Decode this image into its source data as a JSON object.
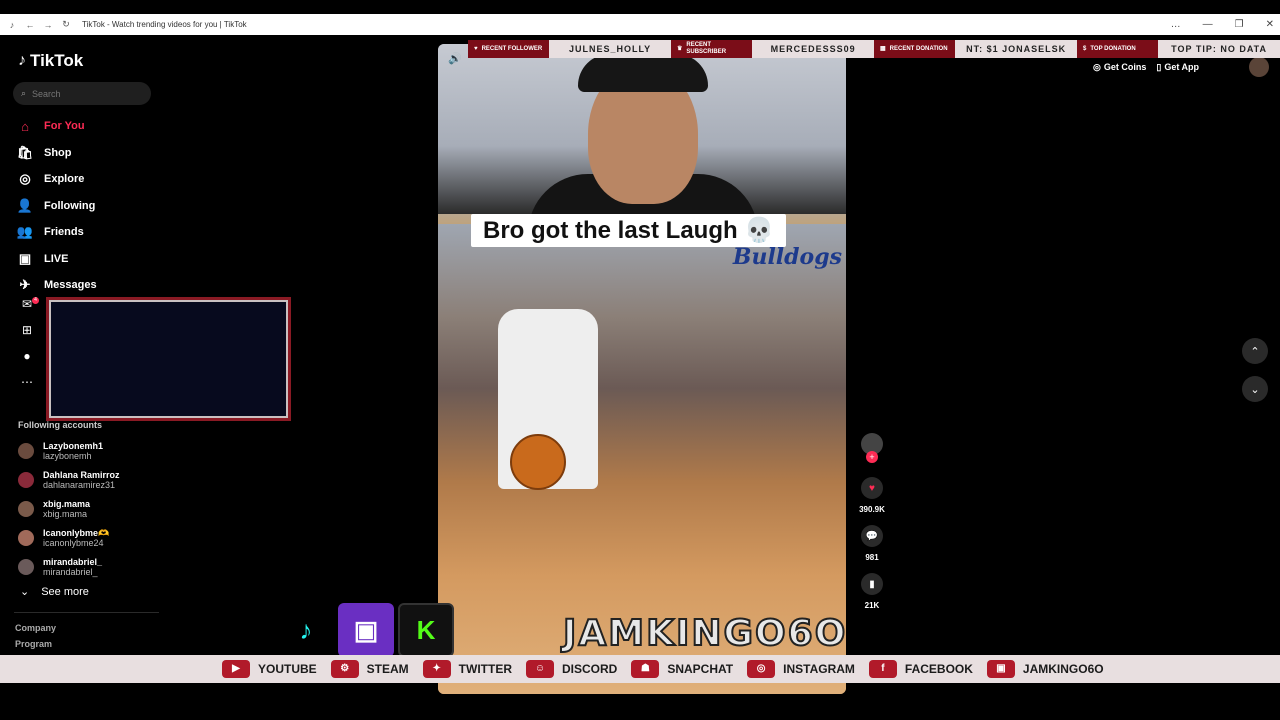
{
  "window": {
    "title": "TikTok - Watch trending videos for you | TikTok",
    "controls": [
      "…",
      "—",
      "❐",
      "✕"
    ]
  },
  "sidebar": {
    "logo": "TikTok",
    "search_placeholder": "Search",
    "nav": [
      {
        "label": "For You",
        "icon": "home-icon",
        "active": true
      },
      {
        "label": "Shop",
        "icon": "shop-icon"
      },
      {
        "label": "Explore",
        "icon": "compass-icon"
      },
      {
        "label": "Following",
        "icon": "following-icon"
      },
      {
        "label": "Friends",
        "icon": "friends-icon"
      },
      {
        "label": "LIVE",
        "icon": "live-icon"
      },
      {
        "label": "Messages",
        "icon": "messages-icon"
      }
    ],
    "inbox_badge": "4",
    "messages_badge": "1",
    "following_title": "Following accounts",
    "following": [
      {
        "name": "Lazybonemh1",
        "handle": "lazybonemh"
      },
      {
        "name": "Dahlana Ramirroz",
        "handle": "dahlanaramirez31"
      },
      {
        "name": "xbig.mama",
        "handle": "xbig.mama"
      },
      {
        "name": "Icanonlybme🫶",
        "handle": "icanonlybme24"
      },
      {
        "name": "mirandabriel_",
        "handle": "mirandabriel_"
      }
    ],
    "see_more": "See more",
    "footer": [
      "Company",
      "Program"
    ]
  },
  "video": {
    "caption": "Bro got the last Laugh 💀",
    "jersey_text": "Bulldogs"
  },
  "actions": {
    "likes": "390.9K",
    "comments": "981",
    "saves": "21K"
  },
  "topbar": {
    "get_coins": "Get Coins",
    "get_app": "Get App"
  },
  "overlay": {
    "alerts": [
      {
        "label": "RECENT FOLLOWER",
        "value": "JULNES_HOLLY"
      },
      {
        "label": "RECENT SUBSCRIBER",
        "value": "MERCEDESSS09"
      },
      {
        "label": "RECENT DONATION",
        "value": "NT: $1   JONASELSK"
      },
      {
        "label": "TOP DONATION",
        "value": "TOP TIP: NO DATA"
      }
    ],
    "brand_name": "JAMKINGO6O",
    "socials": [
      "YOUTUBE",
      "",
      "STEAM",
      "TWITTER",
      "DISCORD",
      "SNAPCHAT",
      "INSTAGRAM",
      "FACEBOOK",
      "JAMKINGO6O"
    ]
  },
  "colors": {
    "accent": "#fe2c55",
    "overlay_red": "#b11a2a"
  }
}
